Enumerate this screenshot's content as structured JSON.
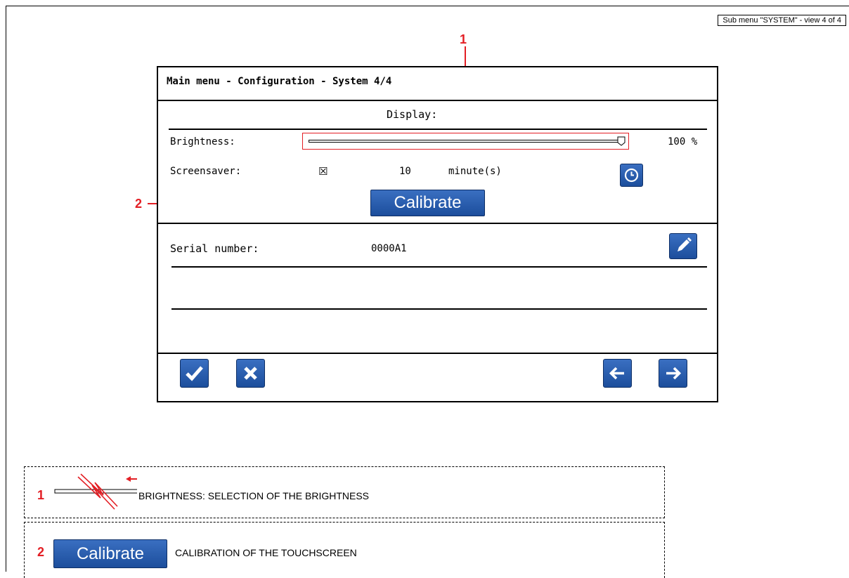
{
  "header": {
    "view_tag": "Sub menu \"SYSTEM\" - view 4 of 4"
  },
  "screen": {
    "title": "Main menu - Configuration - System 4/4",
    "display_section": "Display:",
    "brightness_label": "Brightness:",
    "brightness_value": "100 %",
    "brightness_level": 1.0,
    "screensaver_label": "Screensaver:",
    "screensaver_checked": true,
    "screensaver_check_glyph": "☒",
    "screensaver_minutes": "10",
    "screensaver_unit": "minute(s)",
    "calibrate_label": "Calibrate",
    "serial_label": "Serial number:",
    "serial_value": "0000A1",
    "icons": [
      "clock-icon",
      "edit-pencil-icon",
      "checkmark-icon",
      "close-x-icon",
      "arrow-left-icon",
      "arrow-right-icon"
    ]
  },
  "callouts": {
    "one": "1",
    "two": "2"
  },
  "legend": {
    "item1_number": "1",
    "item1_text": "BRIGHTNESS: SELECTION OF THE  BRIGHTNESS",
    "item2_number": "2",
    "item2_button": "Calibrate",
    "item2_text": "CALIBRATION OF THE TOUCHSCREEN"
  },
  "colors": {
    "accent_blue": "#2558a8",
    "callout_red": "#e31e24"
  }
}
